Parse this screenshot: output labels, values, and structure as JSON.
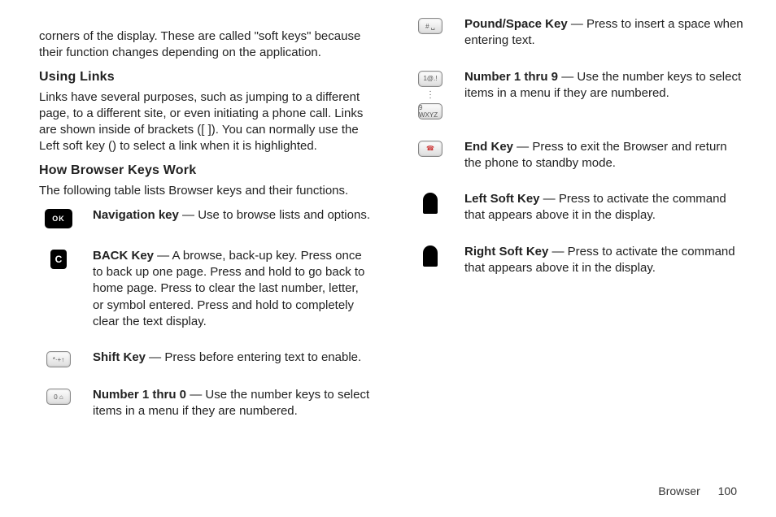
{
  "col1": {
    "intro": "corners of the display. These are called \"soft keys\" because their function changes depending on the application.",
    "h_links": "Using Links",
    "links_body": "Links have several purposes, such as jumping to a different page, to a different site, or even initiating a phone call. Links are shown inside of brackets ([ ]). You can normally use the Left soft key () to select a link when it is highlighted.",
    "h_keys": "How Browser Keys Work",
    "keys_intro": "The following table lists Browser keys and their functions.",
    "entries": [
      {
        "label": "Navigation key",
        "body": " — Use to browse lists and options."
      },
      {
        "label": "BACK Key",
        "body": " — A browse, back-up key. Press once to back up one page. Press and hold to go back to home page. Press to clear the last number, letter, or symbol entered. Press and hold to completely clear the text display."
      },
      {
        "label": "Shift Key",
        "body": " — Press before entering text to enable."
      },
      {
        "label": "Number 1 thru 0",
        "body": " — Use the number keys to select items in a menu if they are numbered."
      }
    ]
  },
  "col2": {
    "entries": [
      {
        "label": "Pound/Space Key",
        "body": " — Press to insert a space when entering text."
      },
      {
        "label": "Number 1 thru 9",
        "body": " — Use the number keys to select items in a menu if they are numbered."
      },
      {
        "label": "End Key",
        "body": " — Press to exit the Browser and return the phone to standby mode."
      },
      {
        "label": "Left Soft Key",
        "body": " — Press to activate the command that appears above it in the display."
      },
      {
        "label": "Right Soft Key",
        "body": " — Press to activate the command that appears above it in the display."
      }
    ]
  },
  "footer": {
    "section": "Browser",
    "page": "100"
  },
  "icon_labels": {
    "ok": "OK",
    "c": "C",
    "shift": "*·+↑",
    "zero": "0 ⌂",
    "pound": "# ␣",
    "one": "1@.!",
    "nine": "9 WXYZ",
    "end_glyph": "☎"
  }
}
